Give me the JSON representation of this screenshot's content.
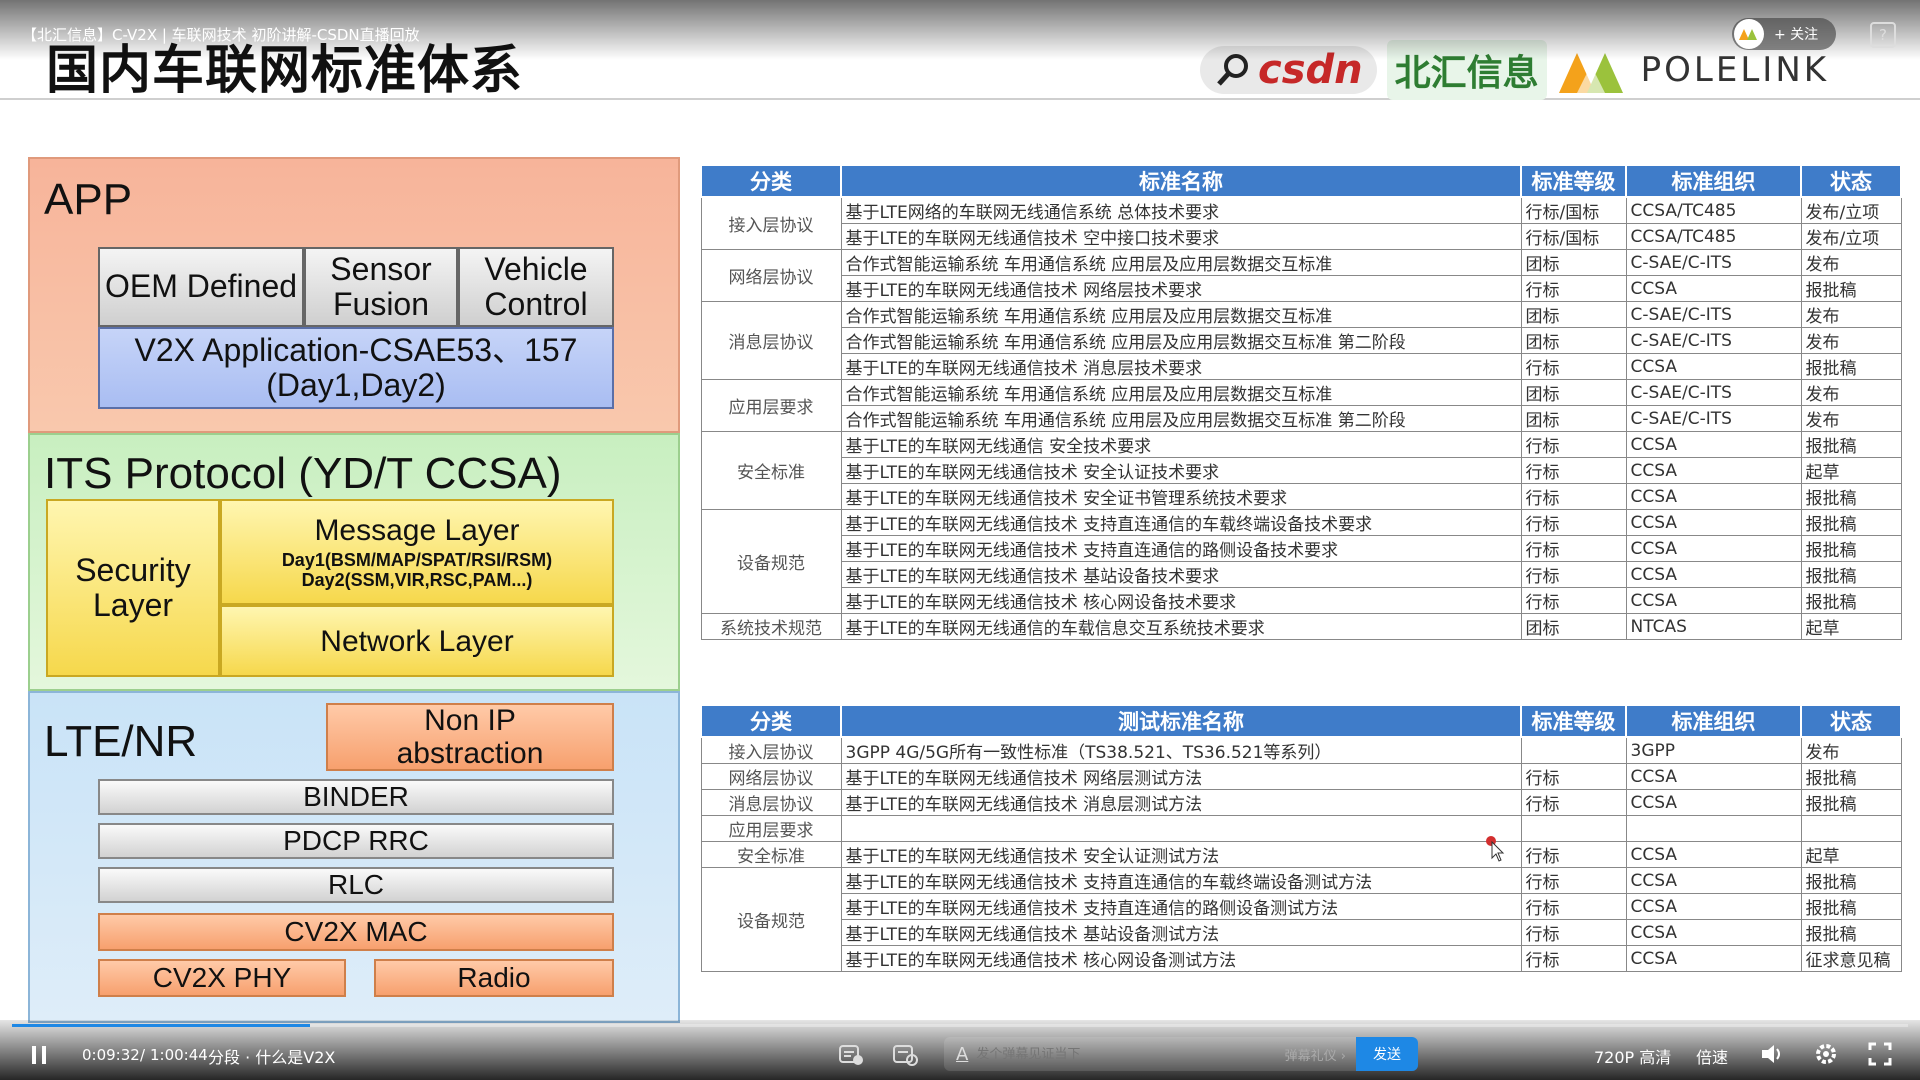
{
  "video": {
    "title": "【北汇信息】C-V2X | 车联网技术 初阶讲解-CSDN直播回放",
    "follow_label": "+ 关注",
    "help_label": "?"
  },
  "slide": {
    "title": "国内车联网标准体系",
    "logos": {
      "csdn": "csdn",
      "beihui": "北汇信息",
      "polelink": "POLELINK"
    },
    "stack": {
      "app": {
        "label": "APP",
        "oem": "OEM Defined",
        "sensor": "Sensor Fusion",
        "vehicle": "Vehicle Control",
        "v2x_app": "V2X Application-CSAE53、157 (Day1,Day2)"
      },
      "its": {
        "label": "ITS Protocol (YD/T CCSA)",
        "security": "Security Layer",
        "message_title": "Message Layer",
        "message_day1": "Day1(BSM/MAP/SPAT/RSI/RSM)",
        "message_day2": "Day2(SSM,VIR,RSC,PAM...)",
        "network": "Network Layer"
      },
      "lte": {
        "label": "LTE/NR",
        "non_ip": "Non IP abstraction",
        "binder": "BINDER",
        "pdcp": "PDCP RRC",
        "rlc": "RLC",
        "mac": "CV2X MAC",
        "phy": "CV2X PHY",
        "radio": "Radio"
      }
    },
    "table1": {
      "headers": [
        "分类",
        "标准名称",
        "标准等级",
        "标准组织",
        "状态"
      ],
      "groups": [
        {
          "category": "接入层协议",
          "rows": [
            [
              "基于LTE网络的车联网无线通信系统 总体技术要求",
              "行标/国标",
              "CCSA/TC485",
              "发布/立项"
            ],
            [
              "基于LTE的车联网无线通信技术 空中接口技术要求",
              "行标/国标",
              "CCSA/TC485",
              "发布/立项"
            ]
          ]
        },
        {
          "category": "网络层协议",
          "rows": [
            [
              "合作式智能运输系统 车用通信系统 应用层及应用层数据交互标准",
              "团标",
              "C-SAE/C-ITS",
              "发布"
            ],
            [
              "基于LTE的车联网无线通信技术 网络层技术要求",
              "行标",
              "CCSA",
              "报批稿"
            ]
          ]
        },
        {
          "category": "消息层协议",
          "rows": [
            [
              "合作式智能运输系统 车用通信系统 应用层及应用层数据交互标准",
              "团标",
              "C-SAE/C-ITS",
              "发布"
            ],
            [
              "合作式智能运输系统 车用通信系统 应用层及应用层数据交互标准 第二阶段",
              "团标",
              "C-SAE/C-ITS",
              "发布"
            ],
            [
              "基于LTE的车联网无线通信技术 消息层技术要求",
              "行标",
              "CCSA",
              "报批稿"
            ]
          ]
        },
        {
          "category": "应用层要求",
          "rows": [
            [
              "合作式智能运输系统 车用通信系统 应用层及应用层数据交互标准",
              "团标",
              "C-SAE/C-ITS",
              "发布"
            ],
            [
              "合作式智能运输系统 车用通信系统 应用层及应用层数据交互标准 第二阶段",
              "团标",
              "C-SAE/C-ITS",
              "发布"
            ]
          ]
        },
        {
          "category": "安全标准",
          "rows": [
            [
              "基于LTE的车联网无线通信 安全技术要求",
              "行标",
              "CCSA",
              "报批稿"
            ],
            [
              "基于LTE的车联网无线通信技术 安全认证技术要求",
              "行标",
              "CCSA",
              "起草"
            ],
            [
              "基于LTE的车联网无线通信技术 安全证书管理系统技术要求",
              "行标",
              "CCSA",
              "报批稿"
            ]
          ]
        },
        {
          "category": "设备规范",
          "rows": [
            [
              "基于LTE的车联网无线通信技术 支持直连通信的车载终端设备技术要求",
              "行标",
              "CCSA",
              "报批稿"
            ],
            [
              "基于LTE的车联网无线通信技术 支持直连通信的路侧设备技术要求",
              "行标",
              "CCSA",
              "报批稿"
            ],
            [
              "基于LTE的车联网无线通信技术 基站设备技术要求",
              "行标",
              "CCSA",
              "报批稿"
            ],
            [
              "基于LTE的车联网无线通信技术 核心网设备技术要求",
              "行标",
              "CCSA",
              "报批稿"
            ]
          ]
        },
        {
          "category": "系统技术规范",
          "rows": [
            [
              "基于LTE的车联网无线通信的车载信息交互系统技术要求",
              "团标",
              "NTCAS",
              "起草"
            ]
          ]
        }
      ]
    },
    "table2": {
      "headers": [
        "分类",
        "测试标准名称",
        "标准等级",
        "标准组织",
        "状态"
      ],
      "groups": [
        {
          "category": "接入层协议",
          "rows": [
            [
              "3GPP 4G/5G所有一致性标准（TS38.521、TS36.521等系列）",
              "",
              "3GPP",
              "发布"
            ]
          ]
        },
        {
          "category": "网络层协议",
          "rows": [
            [
              "基于LTE的车联网无线通信技术 网络层测试方法",
              "行标",
              "CCSA",
              "报批稿"
            ]
          ]
        },
        {
          "category": "消息层协议",
          "rows": [
            [
              "基于LTE的车联网无线通信技术 消息层测试方法",
              "行标",
              "CCSA",
              "报批稿"
            ]
          ]
        },
        {
          "category": "应用层要求",
          "rows": [
            [
              "",
              "",
              "",
              ""
            ]
          ]
        },
        {
          "category": "安全标准",
          "rows": [
            [
              "基于LTE的车联网无线通信技术 安全认证测试方法",
              "行标",
              "CCSA",
              "起草"
            ]
          ]
        },
        {
          "category": "设备规范",
          "rows": [
            [
              "基于LTE的车联网无线通信技术 支持直连通信的车载终端设备测试方法",
              "行标",
              "CCSA",
              "报批稿"
            ],
            [
              "基于LTE的车联网无线通信技术 支持直连通信的路侧设备测试方法",
              "行标",
              "CCSA",
              "报批稿"
            ],
            [
              "基于LTE的车联网无线通信技术 基站设备测试方法",
              "行标",
              "CCSA",
              "报批稿"
            ],
            [
              "基于LTE的车联网无线通信技术 核心网设备测试方法",
              "行标",
              "CCSA",
              "征求意见稿"
            ]
          ]
        }
      ]
    }
  },
  "player": {
    "current_time": "0:09:32",
    "separator": "/",
    "duration": "1:00:44",
    "chapter": "分段 · 什么是V2X",
    "played_fraction": 0.157,
    "danmu_placeholder": "发个弹幕见证当下",
    "danmu_gift": "弹幕礼仪 ›",
    "send_label": "发送",
    "quality": "720P 高清",
    "speed": "倍速",
    "accent": "#1e88e5"
  }
}
